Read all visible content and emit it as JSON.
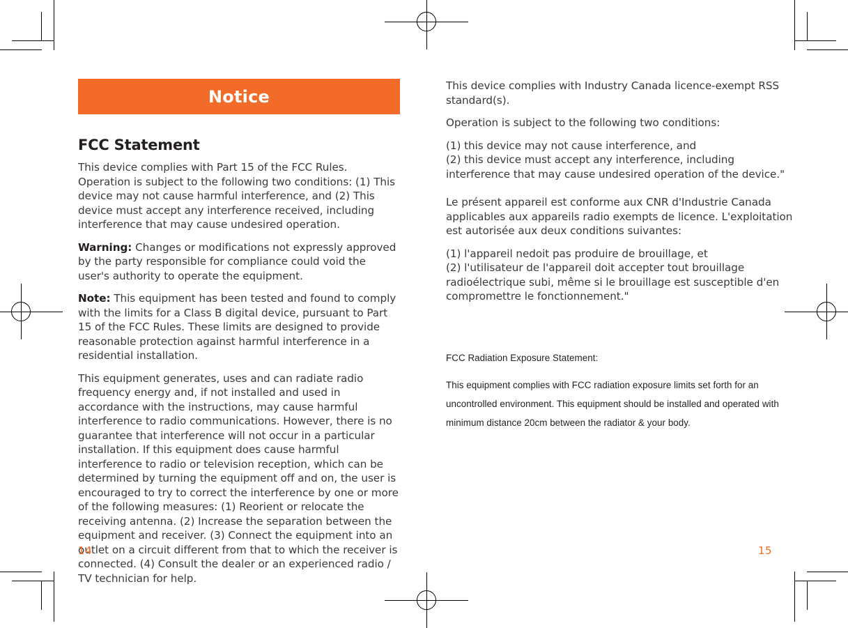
{
  "document": {
    "banner": {
      "title": "Notice",
      "background_color": "#F26B28",
      "text_color": "#FFFFFF"
    },
    "accent_color": "#F26B28",
    "left_page": {
      "folio": "14",
      "heading": "FCC Statement",
      "paragraphs": [
        {
          "lead": "",
          "text": "This device complies with Part 15 of the FCC Rules. Operation is subject to the following two conditions: (1) This device may not cause harmful interference, and (2) This device must accept any interference received, including interference that may cause undesired operation."
        },
        {
          "lead": "Warning:",
          "text": "Changes or modifications not expressly approved by the party responsible for compliance could void the user's authority to operate the equipment."
        },
        {
          "lead": "Note:",
          "text": "This equipment has been tested and found to comply with the limits for a Class B digital device, pursuant to Part 15 of the FCC Rules. These limits are designed to provide reasonable protection against harmful interference in a residential installation."
        },
        {
          "lead": "",
          "text": "This equipment generates, uses and can radiate radio frequency energy and, if not installed and used in accordance with the instructions, may cause harmful interference to radio communications. However, there is no guarantee that interference will not occur in a particular installation. If this equipment does cause harmful interference to radio or television reception, which can be determined by turning the equipment off and on, the user is encouraged to try to correct the interference by one or more of the following measures: (1) Reorient or relocate the receiving antenna. (2) Increase the separation between the equipment and receiver. (3) Connect the equipment into an outlet on a circuit different from that to which the receiver is connected. (4) Consult the dealer or an experienced radio / TV technician for help."
        }
      ]
    },
    "right_page": {
      "folio": "15",
      "paragraphs": [
        "This device complies with Industry Canada licence-exempt RSS standard(s).",
        "Operation is subject to the following two conditions:",
        "(1) this device may not cause interference, and\n(2) this device must accept any interference, including interference that may cause undesired operation of the device.\"",
        "Le présent appareil est conforme aux CNR d'Industrie Canada applicables aux appareils radio exempts de licence. L'exploitation est autorisée aux deux conditions suivantes:",
        "(1) l'appareil nedoit pas produire de brouillage, et\n(2) l'utilisateur de l'appareil doit accepter tout brouillage radioélectrique subi, même si le brouillage est susceptible d'en compromettre le fonctionnement.\""
      ],
      "exposure_statement": {
        "heading": "FCC Radiation Exposure Statement:",
        "body": "This equipment complies with FCC radiation exposure limits set forth for an uncontrolled environment. This equipment should be installed and operated with minimum distance 20cm between the radiator & your body."
      }
    }
  }
}
